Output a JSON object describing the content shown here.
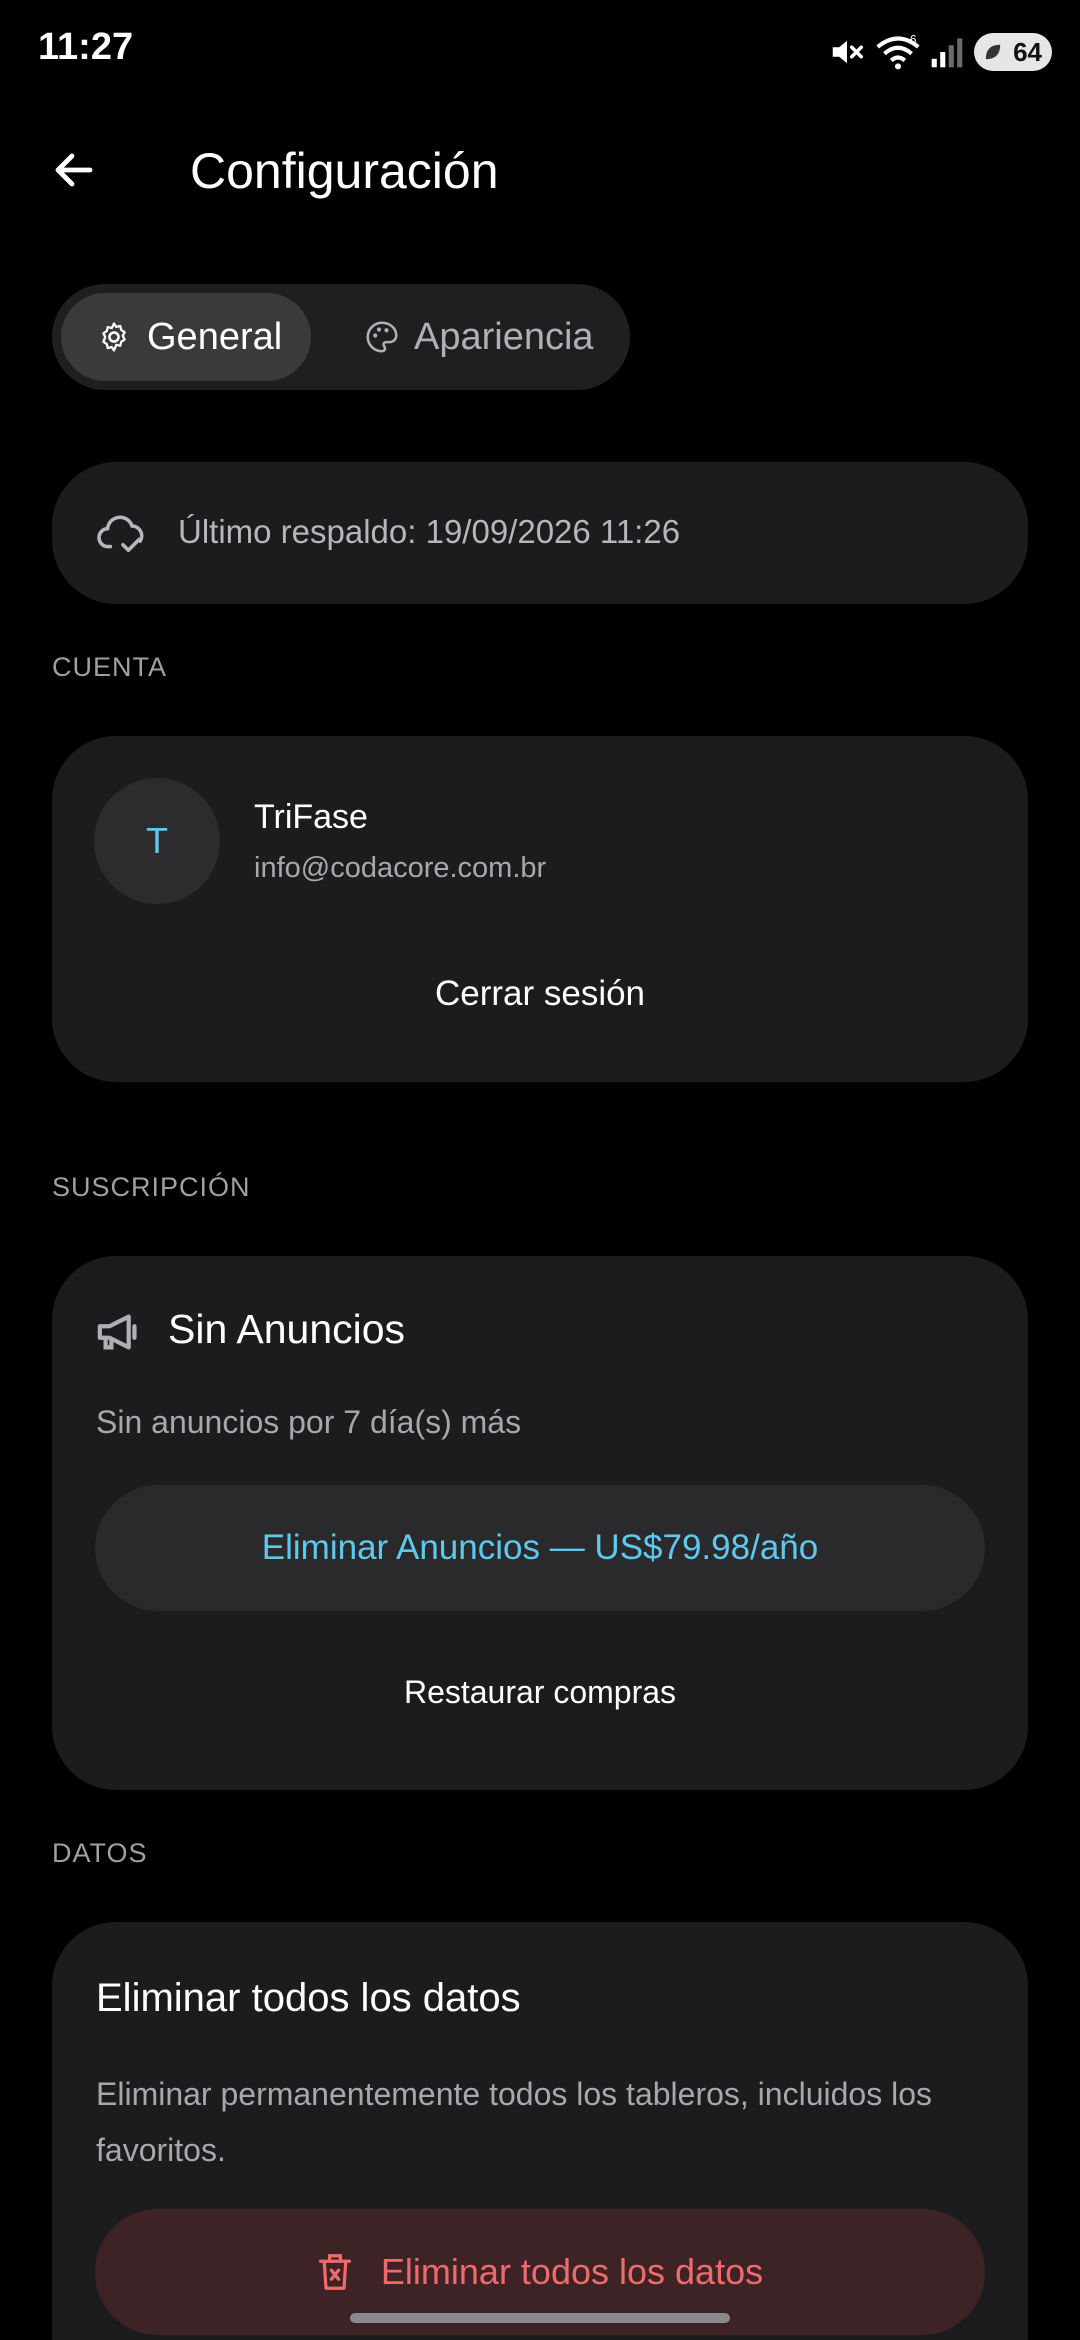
{
  "status_bar": {
    "time": "11:27",
    "battery": "64",
    "wifi_badge": "6"
  },
  "header": {
    "title": "Configuración"
  },
  "tabs": [
    {
      "label": "General",
      "icon": "gear-icon",
      "selected": true
    },
    {
      "label": "Apariencia",
      "icon": "palette-icon",
      "selected": false
    }
  ],
  "backup": {
    "text": "Último respaldo: 19/09/2026 11:26",
    "icon": "cloud-check-icon"
  },
  "account": {
    "section_label": "CUENTA",
    "avatar_initial": "T",
    "name": "TriFase",
    "email": "info@codacore.com.br",
    "logout_label": "Cerrar sesión"
  },
  "subscription": {
    "section_label": "SUSCRIPCIÓN",
    "title": "Sin Anuncios",
    "description": "Sin anuncios por 7 día(s) más",
    "remove_ads_label": "Eliminar Anuncios — US$79.98/año",
    "restore_label": "Restaurar compras"
  },
  "data": {
    "section_label": "DATOS",
    "title": "Eliminar todos los datos",
    "description": "Eliminar permanentemente todos los tableros, incluidos los favoritos.",
    "delete_label": "Eliminar todos los datos"
  },
  "colors": {
    "accent": "#5ec8ef",
    "danger": "#ef6b6b",
    "card_bg": "#1c1c1e",
    "background": "#000000"
  }
}
